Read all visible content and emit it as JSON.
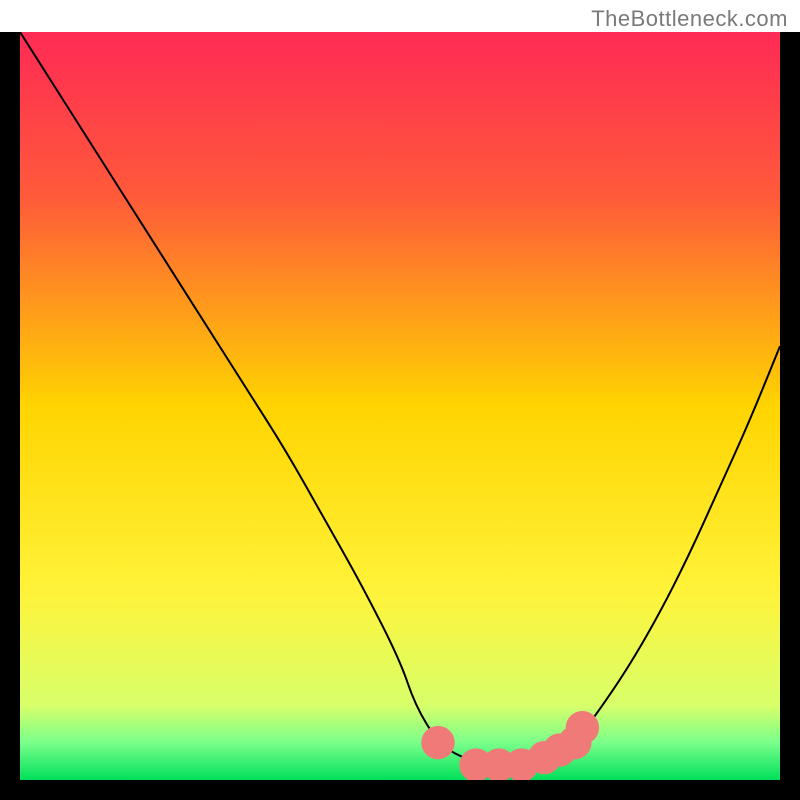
{
  "attribution": "TheBottleneck.com",
  "chart_data": {
    "type": "line",
    "title": "",
    "xlabel": "",
    "ylabel": "",
    "xlim": [
      0,
      100
    ],
    "ylim": [
      0,
      100
    ],
    "background_gradient": {
      "stops": [
        {
          "offset": 0,
          "color": "#ff2a55"
        },
        {
          "offset": 22,
          "color": "#ff5a3a"
        },
        {
          "offset": 50,
          "color": "#ffd400"
        },
        {
          "offset": 75,
          "color": "#fff33a"
        },
        {
          "offset": 90,
          "color": "#d8ff6a"
        },
        {
          "offset": 95,
          "color": "#7aff8a"
        },
        {
          "offset": 100,
          "color": "#00e05a"
        }
      ]
    },
    "series": [
      {
        "name": "bottleneck-curve",
        "color": "#000000",
        "x": [
          0,
          5,
          10,
          15,
          20,
          25,
          30,
          35,
          40,
          45,
          50,
          52,
          55,
          58,
          62,
          66,
          70,
          73,
          76,
          80,
          84,
          88,
          92,
          96,
          100
        ],
        "y": [
          100,
          92,
          84,
          76,
          68,
          60,
          52,
          44,
          35,
          26,
          16,
          10,
          5,
          3,
          2,
          2,
          3,
          5,
          9,
          15,
          22,
          30,
          39,
          48,
          58
        ]
      }
    ],
    "markers": {
      "name": "optimum-band",
      "color": "#ef7a78",
      "points": [
        {
          "x": 55,
          "y": 5
        },
        {
          "x": 60,
          "y": 2
        },
        {
          "x": 63,
          "y": 2
        },
        {
          "x": 66,
          "y": 2
        },
        {
          "x": 69,
          "y": 3
        },
        {
          "x": 71,
          "y": 4
        },
        {
          "x": 73,
          "y": 5
        },
        {
          "x": 74,
          "y": 7
        }
      ],
      "radius": 2.2
    }
  }
}
